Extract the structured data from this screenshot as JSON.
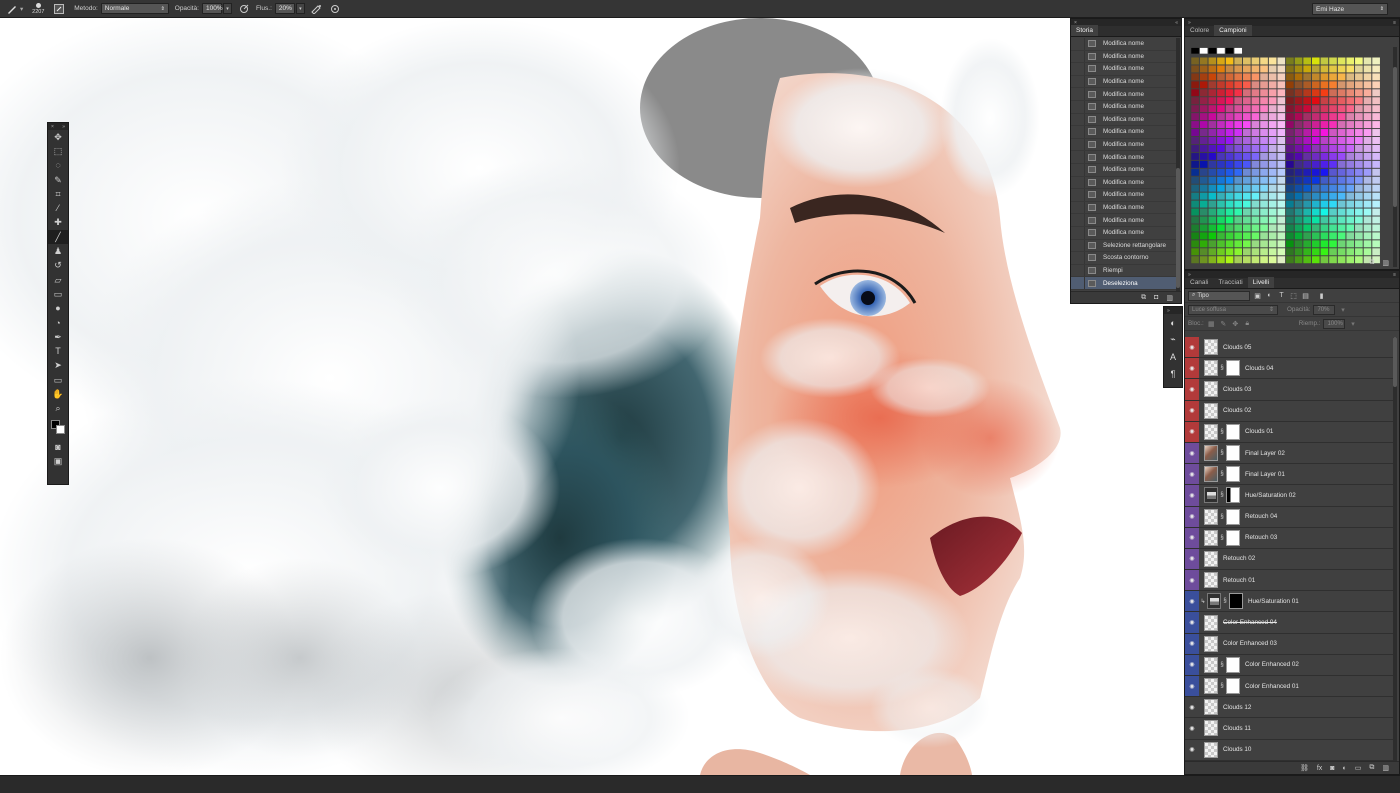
{
  "options_bar": {
    "brush_size": "2207",
    "method_label": "Metodo:",
    "method_value": "Normale",
    "opacity_label": "Opacità:",
    "opacity_value": "100%",
    "flow_label": "Flus.:",
    "flow_value": "20%",
    "workspace": "Emi Haze"
  },
  "history_panel": {
    "tab": "Storia",
    "items": [
      "Modifica nome",
      "Modifica nome",
      "Modifica nome",
      "Modifica nome",
      "Modifica nome",
      "Modifica nome",
      "Modifica nome",
      "Modifica nome",
      "Modifica nome",
      "Modifica nome",
      "Modifica nome",
      "Modifica nome",
      "Modifica nome",
      "Modifica nome",
      "Modifica nome",
      "Modifica nome",
      "Selezione rettangolare",
      "Scosta contorno",
      "Riempi",
      "Deseleziona"
    ],
    "active_index": 19
  },
  "swatch_panel": {
    "tabs": [
      "Colore",
      "Campioni"
    ],
    "active_tab": "Campioni"
  },
  "layers_panel": {
    "tabs": [
      "Canali",
      "Tracciati",
      "Livelli"
    ],
    "active_tab": "Livelli",
    "filter_kind": "Tipo",
    "blend_mode": "Luce soffusa",
    "opacity_label": "Opacità:",
    "opacity_value": "70%",
    "lock_label": "Bloc.:",
    "fill_label": "Riemp.:",
    "fill_value": "100%",
    "layers": [
      {
        "name": "Clouds 05",
        "tag": "#b23a3a",
        "thumb": "checker",
        "mask": "none"
      },
      {
        "name": "Clouds 04",
        "tag": "#b23a3a",
        "thumb": "checker",
        "mask": "white"
      },
      {
        "name": "Clouds 03",
        "tag": "#b23a3a",
        "thumb": "checker",
        "mask": "none"
      },
      {
        "name": "Clouds 02",
        "tag": "#b23a3a",
        "thumb": "checker",
        "mask": "none"
      },
      {
        "name": "Clouds 01",
        "tag": "#b23a3a",
        "thumb": "checker",
        "mask": "white"
      },
      {
        "name": "Final Layer 02",
        "tag": "#6e4c9c",
        "thumb": "img",
        "mask": "white"
      },
      {
        "name": "Final Layer 01",
        "tag": "#6e4c9c",
        "thumb": "img",
        "mask": "white"
      },
      {
        "name": "Hue/Saturation 02",
        "tag": "#6e4c9c",
        "thumb": "adj",
        "mask": "partial"
      },
      {
        "name": "Retouch 04",
        "tag": "#6e4c9c",
        "thumb": "checker",
        "mask": "white"
      },
      {
        "name": "Retouch 03",
        "tag": "#6e4c9c",
        "thumb": "checker",
        "mask": "white"
      },
      {
        "name": "Retouch 02",
        "tag": "#6e4c9c",
        "thumb": "checker",
        "mask": "none"
      },
      {
        "name": "Retouch 01",
        "tag": "#6e4c9c",
        "thumb": "checker",
        "mask": "none"
      },
      {
        "name": "Hue/Saturation 01",
        "tag": "#3a4f9c",
        "thumb": "adj",
        "mask": "black"
      },
      {
        "name": "Color Enhanced 04",
        "tag": "#3a4f9c",
        "thumb": "checker",
        "mask": "none"
      },
      {
        "name": "Color Enhanced 03",
        "tag": "#3a4f9c",
        "thumb": "checker",
        "mask": "none"
      },
      {
        "name": "Color Enhanced 02",
        "tag": "#3a4f9c",
        "thumb": "checker",
        "mask": "white"
      },
      {
        "name": "Color Enhanced 01",
        "tag": "#3a4f9c",
        "thumb": "checker",
        "mask": "white"
      },
      {
        "name": "Clouds 12",
        "tag": "#404040",
        "thumb": "checker",
        "mask": "none"
      },
      {
        "name": "Clouds 11",
        "tag": "#404040",
        "thumb": "checker",
        "mask": "none"
      },
      {
        "name": "Clouds 10",
        "tag": "#404040",
        "thumb": "checker",
        "mask": "none"
      }
    ]
  },
  "icons": {
    "tools": [
      "move-icon",
      "marquee-icon",
      "lasso-icon",
      "quick-selection-icon",
      "crop-icon",
      "eyedropper-icon",
      "healing-brush-icon",
      "brush-icon",
      "clone-stamp-icon",
      "history-brush-icon",
      "eraser-icon",
      "gradient-icon",
      "blur-icon",
      "dodge-icon",
      "pen-icon",
      "type-icon",
      "path-selection-icon",
      "rectangle-icon",
      "hand-icon",
      "zoom-icon"
    ]
  },
  "colors": {
    "ui_bg": "#282828",
    "panel_bg": "#404040",
    "selection": "#505d72"
  }
}
